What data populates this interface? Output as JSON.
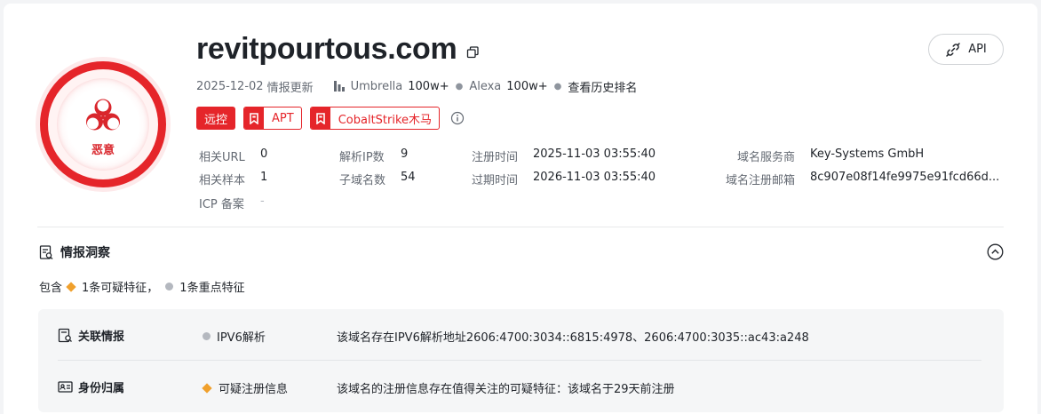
{
  "domain": "revitpourtous.com",
  "verdict_label": "恶意",
  "api_label": "API",
  "subline": {
    "date": "2025-12-02",
    "update_text": "情报更新",
    "umbrella_label": "Umbrella",
    "umbrella_rank": "100w+",
    "alexa_label": "Alexa",
    "alexa_rank": "100w+",
    "history_link": "查看历史排名"
  },
  "tags": [
    {
      "label": "远控",
      "style": "solid"
    },
    {
      "label": "APT",
      "style": "outline"
    },
    {
      "label": "CobaltStrike木马",
      "style": "outline"
    }
  ],
  "details": {
    "related_url": {
      "label": "相关URL",
      "value": "0"
    },
    "related_sample": {
      "label": "相关样本",
      "value": "1"
    },
    "icp": {
      "label": "ICP 备案",
      "value": "-"
    },
    "resolved_ip": {
      "label": "解析IP数",
      "value": "9"
    },
    "subdomain": {
      "label": "子域名数",
      "value": "54"
    },
    "reg_time": {
      "label": "注册时间",
      "value": "2025-11-03 03:55:40"
    },
    "exp_time": {
      "label": "过期时间",
      "value": "2026-11-03 03:55:40"
    },
    "registrar": {
      "label": "域名服务商",
      "value": "Key-Systems GmbH"
    },
    "reg_email": {
      "label": "域名注册邮箱",
      "value": "8c907e08f14fe9975e91fcd66d..."
    }
  },
  "insight": {
    "title": "情报洞察",
    "contains_prefix": "包含",
    "suspicious_count": "1条可疑特征，",
    "key_count": "1条重点特征"
  },
  "insight_rows": [
    {
      "category": "关联情报",
      "feature": "IPV6解析",
      "feature_marker": "dot",
      "description": "该域名存在IPV6解析地址2606:4700:3034::6815:4978、2606:4700:3035::ac43:a248"
    },
    {
      "category": "身份归属",
      "feature": "可疑注册信息",
      "feature_marker": "diamond",
      "description": "该域名的注册信息存在值得关注的可疑特征：该域名于29天前注册"
    }
  ],
  "colors": {
    "danger": "#e5252a",
    "suspicious": "#f0a02c",
    "key": "#b4b8bf"
  }
}
